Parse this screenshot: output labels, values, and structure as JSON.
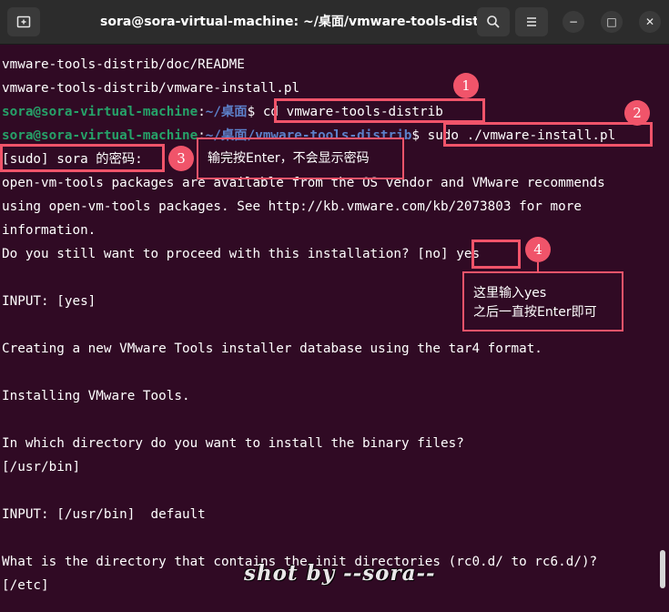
{
  "window": {
    "title": "sora@sora-virtual-machine: ~/桌面/vmware-tools-distrib",
    "new_tab_icon": "new-tab-icon",
    "search_icon": "search-icon",
    "menu_icon": "hamburger-menu-icon",
    "minimize_glyph": "−",
    "maximize_glyph": "□",
    "close_glyph": "✕"
  },
  "terminal": {
    "lines": [
      "vmware-tools-distrib/doc/README",
      "vmware-tools-distrib/vmware-install.pl",
      "",
      "",
      "[sudo] sora 的密码:",
      "open-vm-tools packages are available from the OS vendor and VMware recommends",
      "using open-vm-tools packages. See http://kb.vmware.com/kb/2073803 for more",
      "information.",
      "Do you still want to proceed with this installation? [no] yes",
      "",
      "INPUT: [yes]",
      "",
      "Creating a new VMware Tools installer database using the tar4 format.",
      "",
      "Installing VMware Tools.",
      "",
      "In which directory do you want to install the binary files?",
      "[/usr/bin]",
      "",
      "INPUT: [/usr/bin]  default",
      "",
      "What is the directory that contains the init directories (rc0.d/ to rc6.d/)?",
      "[/etc]"
    ],
    "prompt_user": "sora@sora-virtual-machine",
    "prompt_sep": ":",
    "prompt_path": "~/桌面",
    "prompt_path2": "~/桌面/vmware-tools-distrib",
    "prompt_dollar": "$",
    "cmd1": " cd vmware-tools-distrib",
    "cmd2": " sudo ./vmware-install.pl",
    "partial_top": "                             "
  },
  "annotations": {
    "badge1": "1",
    "badge2": "2",
    "badge3": "3",
    "badge4": "4",
    "note3": "输完按Enter，不会显示密码",
    "note4_line1": "这里输入yes",
    "note4_line2": "之后一直按Enter即可",
    "watermark": "shot by --sora--"
  },
  "colors": {
    "background": "#300a24",
    "prompt_user": "#26a269",
    "prompt_path": "#5c80c9",
    "annotation": "#f0546a"
  }
}
